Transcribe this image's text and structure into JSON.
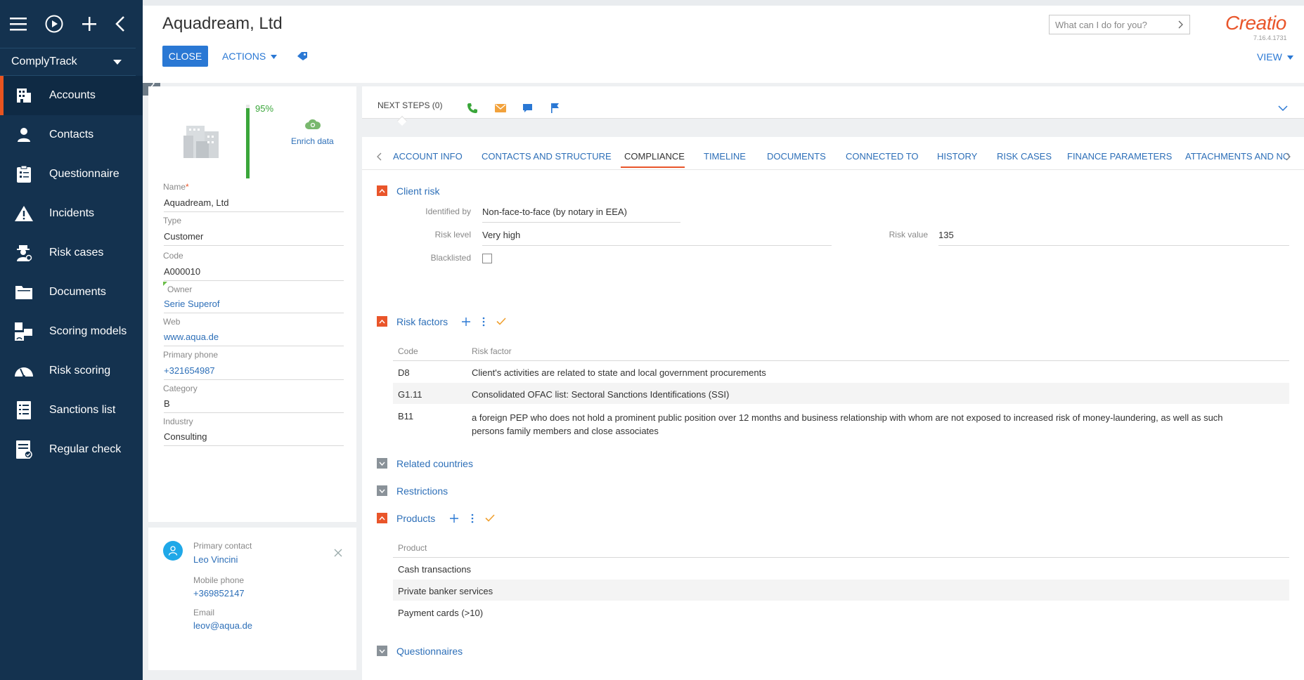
{
  "app": {
    "name": "ComplyTrack",
    "nav": [
      {
        "label": "Accounts",
        "icon": "building-icon",
        "active": true
      },
      {
        "label": "Contacts",
        "icon": "person-icon"
      },
      {
        "label": "Questionnaire",
        "icon": "clipboard-icon"
      },
      {
        "label": "Incidents",
        "icon": "warning-icon"
      },
      {
        "label": "Risk cases",
        "icon": "detective-icon"
      },
      {
        "label": "Documents",
        "icon": "folder-icon"
      },
      {
        "label": "Scoring models",
        "icon": "model-icon"
      },
      {
        "label": "Risk scoring",
        "icon": "gauge-icon"
      },
      {
        "label": "Sanctions list",
        "icon": "list-icon"
      },
      {
        "label": "Regular check",
        "icon": "checklist-icon"
      }
    ]
  },
  "header": {
    "title": "Aquadream, Ltd",
    "close_label": "CLOSE",
    "actions_label": "ACTIONS",
    "search_placeholder": "What can I do for you?",
    "logo_text": "Creatio",
    "version": "7.16.4.1731",
    "view_label": "VIEW"
  },
  "profile": {
    "completeness": "95%",
    "completeness_value": 0.95,
    "enrich_label": "Enrich data",
    "fields": [
      {
        "label": "Name",
        "value": "Aquadream, Ltd",
        "required": true
      },
      {
        "label": "Type",
        "value": "Customer"
      },
      {
        "label": "Code",
        "value": "A000010"
      },
      {
        "label": "Owner",
        "value": "Serie Superof",
        "link": true
      },
      {
        "label": "Web",
        "value": "www.aqua.de",
        "link": true
      },
      {
        "label": "Primary phone",
        "value": "+321654987",
        "link": true
      },
      {
        "label": "Category",
        "value": "B"
      },
      {
        "label": "Industry",
        "value": "Consulting"
      }
    ]
  },
  "contact_card": {
    "primary_contact_label": "Primary contact",
    "primary_contact": "Leo Vincini",
    "mobile_label": "Mobile phone",
    "mobile": "+369852147",
    "email_label": "Email",
    "email": "leov@aqua.de"
  },
  "next_steps": {
    "label": "NEXT STEPS (0)"
  },
  "tabs": [
    "ACCOUNT INFO",
    "CONTACTS AND STRUCTURE",
    "COMPLIANCE",
    "TIMELINE",
    "DOCUMENTS",
    "CONNECTED TO",
    "HISTORY",
    "RISK CASES",
    "FINANCE PARAMETERS",
    "ATTACHMENTS AND NO"
  ],
  "active_tab": "COMPLIANCE",
  "client_risk": {
    "title": "Client risk",
    "identified_by_label": "Identified by",
    "identified_by": "Non-face-to-face (by notary in EEA)",
    "risk_level_label": "Risk level",
    "risk_level": "Very high",
    "risk_value_label": "Risk value",
    "risk_value": "135",
    "blacklisted_label": "Blacklisted",
    "blacklisted": false
  },
  "risk_factors": {
    "title": "Risk factors",
    "columns": [
      "Code",
      "Risk factor"
    ],
    "rows": [
      {
        "code": "D8",
        "factor": "Client's activities are related to state and local government procurements"
      },
      {
        "code": "G1.11",
        "factor": "Consolidated OFAC list: Sectoral Sanctions Identifications (SSI)"
      },
      {
        "code": "B11",
        "factor": "a foreign PEP who does not hold a prominent public position over 12 months and business relationship with whom are not exposed to increased risk of money-laundering, as well as such",
        "factor2": "persons family members and close associates"
      }
    ]
  },
  "related_countries": {
    "title": "Related countries"
  },
  "restrictions": {
    "title": "Restrictions"
  },
  "products": {
    "title": "Products",
    "columns": [
      "Product"
    ],
    "rows": [
      "Cash transactions",
      "Private banker services",
      "Payment cards (>10)"
    ]
  },
  "questionnaires": {
    "title": "Questionnaires"
  }
}
